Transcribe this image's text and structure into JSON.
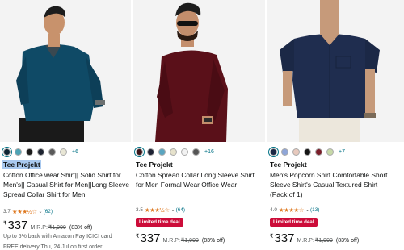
{
  "products": [
    {
      "brand": "Tee Projekt",
      "title": "Cotton Office wear Shirt|| Solid Shirt for Men's|| Casual Shirt for Men||Long Sleeve Spread Collar Shirt for Men",
      "swatches": [
        "#0e2433",
        "#4da3b5",
        "#1b1b1b",
        "#1e2430",
        "#5a5a5a",
        "#e8e6d5"
      ],
      "more_colors": "+6",
      "rating": "3.7",
      "stars": "★★★½☆",
      "reviews": "(62)",
      "deal": "",
      "currency": "₹",
      "price": "337",
      "mrp_label": "M.R.P:",
      "mrp": "₹1,999",
      "discount": "(83% off)",
      "cashback": "Up to 5% back with Amazon Pay ICICI card",
      "cut_text": "FREE delivery Thu, 24 Jul on first order"
    },
    {
      "brand": "Tee Projekt",
      "title": "Cotton Spread Collar Long Sleeve Shirt for Men Formal Wear Office Wear",
      "swatches": [
        "#3a1418",
        "#1e2233",
        "#5aa5c0",
        "#e6e2cc",
        "#f2f2f2",
        "#555555"
      ],
      "more_colors": "+16",
      "rating": "3.5",
      "stars": "★★★½☆",
      "reviews": "(64)",
      "deal": "Limited time deal",
      "currency": "₹",
      "price": "337",
      "mrp_label": "M.R.P:",
      "mrp": "₹1,999",
      "discount": "(83% off)"
    },
    {
      "brand": "Tee Projekt",
      "title": "Men's Popcorn Shirt Comfortable Short Sleeve Shirt's Casual Textured Shirt (Pack of 1)",
      "swatches": [
        "#1c2845",
        "#8fa6d8",
        "#e7c9bd",
        "#151515",
        "#7a1e2a",
        "#c7d9a8"
      ],
      "more_colors": "+7",
      "rating": "4.0",
      "stars": "★★★★☆",
      "reviews": "(13)",
      "deal": "Limited time deal",
      "currency": "₹",
      "price": "337",
      "mrp_label": "M.R.P:",
      "mrp": "₹1,999",
      "discount": "(83% off)"
    }
  ]
}
